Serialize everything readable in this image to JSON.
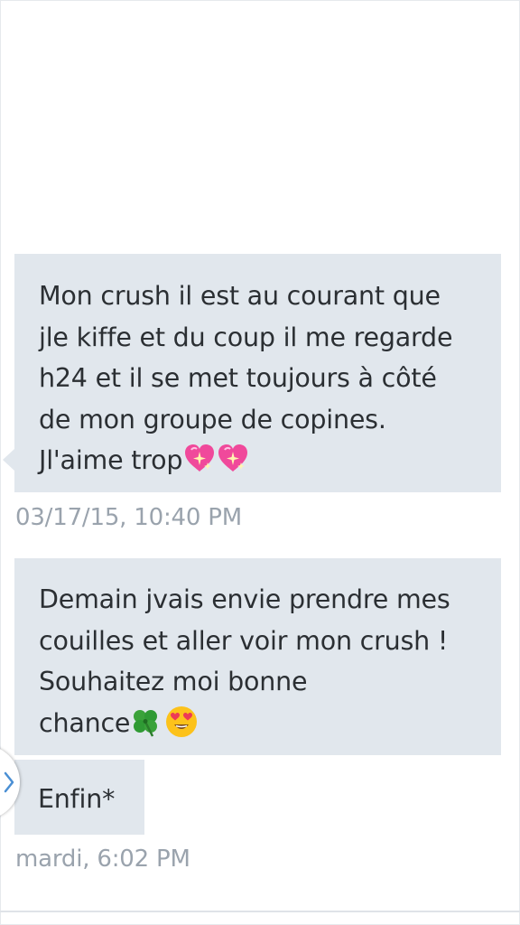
{
  "messages": [
    {
      "lines": [
        "Mon crush il est au courant que",
        "jle kiffe et du coup il me regarde",
        "h24 et il se met toujours à côté",
        "de mon groupe de copines.",
        "Jl'aime trop"
      ],
      "emojis": [
        "sparkling-heart",
        "sparkling-heart"
      ],
      "timestamp": "03/17/15, 10:40 PM"
    },
    {
      "lines": [
        "Demain jvais envie prendre mes",
        "couilles et aller voir mon crush !",
        "Souhaitez moi bonne",
        "chance"
      ],
      "emojis": [
        "four-leaf-clover",
        "heart-eyes"
      ]
    },
    {
      "lines": [
        "Enfin*"
      ],
      "timestamp": "mardi, 6:02 PM"
    }
  ],
  "colors": {
    "bubble_bg": "#e1e7ed",
    "text": "#2b2f33",
    "timestamp": "#9aa3ad",
    "handle_chevron": "#4a8fd4"
  },
  "side_handle_icon": "chevron-right-icon"
}
